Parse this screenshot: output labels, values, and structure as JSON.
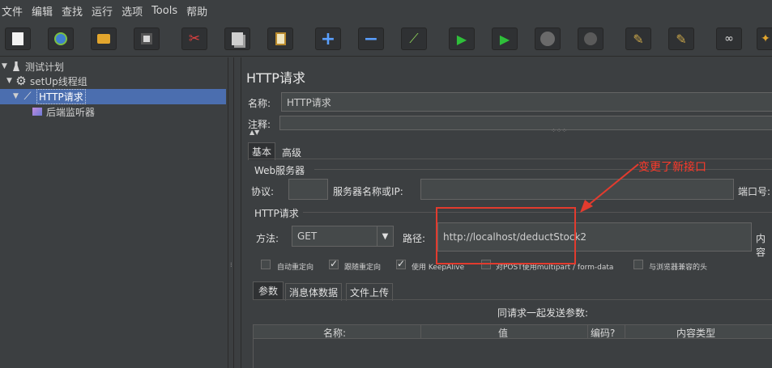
{
  "menu": {
    "items": [
      "文件",
      "编辑",
      "查找",
      "运行",
      "选项",
      "Tools",
      "帮助"
    ]
  },
  "toolbar": {
    "buttons": [
      "new",
      "templates",
      "open",
      "save",
      "cut",
      "copy",
      "paste",
      "expand",
      "collapse",
      "toggle",
      "start",
      "start-no-pause",
      "stop",
      "shutdown",
      "clear",
      "clear-all",
      "search",
      "reset-search"
    ]
  },
  "tree": {
    "items": [
      {
        "label": "测试计划",
        "icon": "flask-icon"
      },
      {
        "label": "setUp线程组",
        "icon": "gear-icon"
      },
      {
        "label": "HTTP请求",
        "icon": "pipette-icon",
        "selected": true
      },
      {
        "label": "后端监听器",
        "icon": "chart-icon"
      }
    ]
  },
  "panel": {
    "title": "HTTP请求",
    "name_label": "名称:",
    "name_value": "HTTP请求",
    "comment_label": "注释:",
    "tabs": [
      "基本",
      "高级"
    ],
    "web_server": {
      "section": "Web服务器",
      "protocol_label": "协议:",
      "protocol_value": "",
      "server_label": "服务器名称或IP:",
      "server_value": "",
      "port_label": "端口号:"
    },
    "http_request": {
      "section": "HTTP请求",
      "method_label": "方法:",
      "method_value": "GET",
      "path_label": "路径:",
      "path_value": "http://localhost/deductStock2",
      "encoding_label": "内容"
    },
    "options": [
      {
        "label": "自动重定向",
        "checked": false
      },
      {
        "label": "跟随重定向",
        "checked": true
      },
      {
        "label": "使用 KeepAlive",
        "checked": true
      },
      {
        "label": "对POST使用multipart / form-data",
        "checked": false
      },
      {
        "label": "与浏览器兼容的头",
        "checked": false
      }
    ],
    "subtabs": [
      "参数",
      "消息体数据",
      "文件上传"
    ],
    "params_caption": "同请求一起发送参数:",
    "columns": [
      "名称:",
      "值",
      "编码?",
      "内容类型"
    ]
  },
  "annotation": {
    "text": "变更了新接口",
    "color": "#ff3a2a"
  }
}
